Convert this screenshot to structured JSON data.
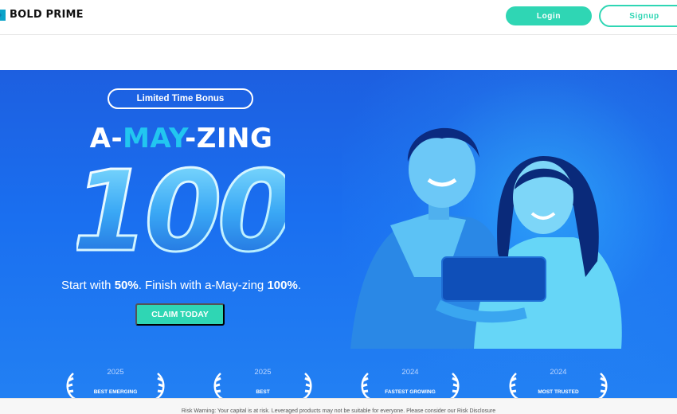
{
  "header": {
    "brand": "BOLD PRIME",
    "login_label": "Login",
    "signup_label": "Signup"
  },
  "hero": {
    "badge": "Limited Time Bonus",
    "headline_prefix": "A-",
    "headline_highlight": "MAY",
    "headline_suffix": "-ZING",
    "big_number": "100",
    "sub_parts": [
      "Start with ",
      "50%",
      ". Finish with a-May-zing ",
      "100%",
      "."
    ],
    "cta_label": "CLAIM TODAY"
  },
  "awards": [
    {
      "year": "2025",
      "title": "BEST EMERGING"
    },
    {
      "year": "2025",
      "title": "BEST"
    },
    {
      "year": "2024",
      "title": "FASTEST GROWING"
    },
    {
      "year": "2024",
      "title": "MOST TRUSTED"
    }
  ],
  "footer": {
    "risk_warning": "Risk Warning: Your capital is at risk. Leveraged products may not be suitable for everyone. Please consider our Risk Disclosure"
  },
  "colors": {
    "accent": "#2fd6b4",
    "hero_blue": "#1a6ff0",
    "highlight": "#22c6f0"
  },
  "icons": [
    "logo-icon",
    "laurel-icon"
  ]
}
